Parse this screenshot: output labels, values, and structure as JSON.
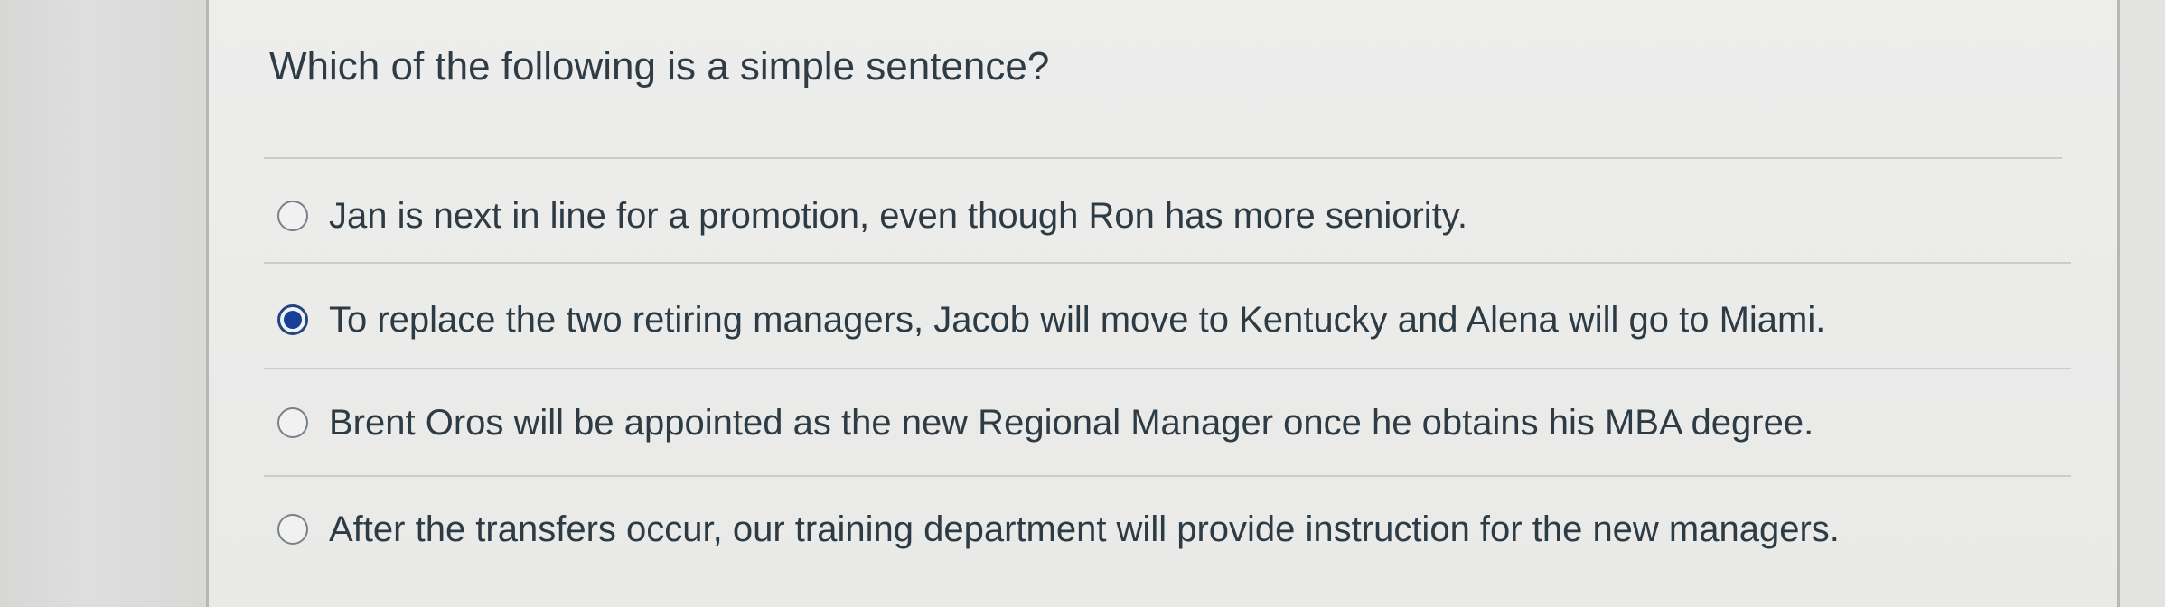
{
  "quiz": {
    "question": "Which of the following is a simple sentence?",
    "answers": [
      {
        "text": "Jan is next in line for a promotion, even though Ron has more seniority.",
        "selected": false
      },
      {
        "text": "To replace the two retiring managers, Jacob will move to Kentucky and Alena will go to Miami.",
        "selected": true
      },
      {
        "text": "Brent Oros will be appointed as the new Regional Manager once he obtains his MBA degree.",
        "selected": false
      },
      {
        "text": "After the transfers occur, our training department will provide instruction for the new managers.",
        "selected": false
      }
    ]
  },
  "colors": {
    "selected_radio": "#183f98",
    "text": "#2d3b45",
    "divider": "#cbcbca"
  }
}
